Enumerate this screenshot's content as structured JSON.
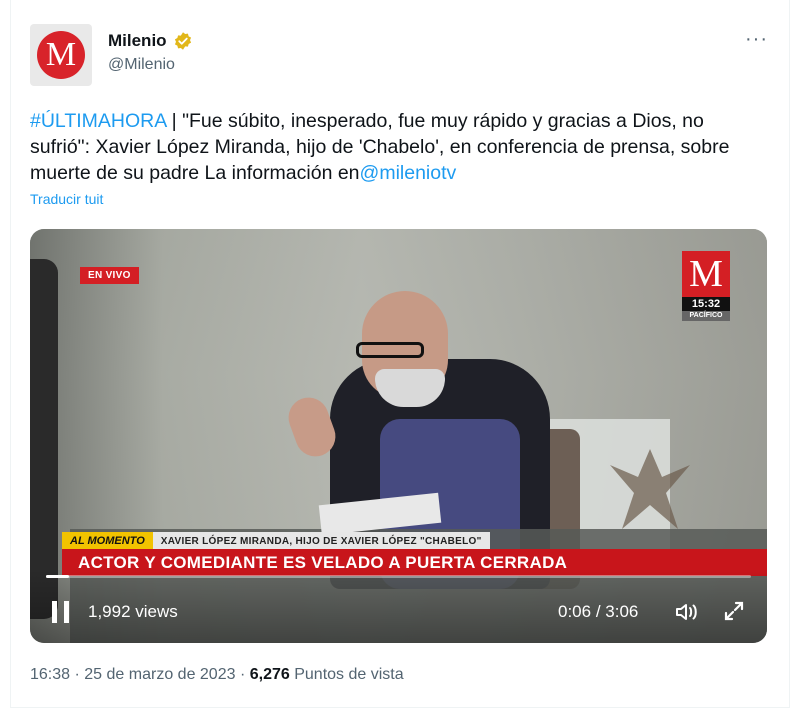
{
  "author": {
    "name": "Milenio",
    "handle": "@Milenio",
    "avatar_letter": "M"
  },
  "menu": {
    "more_label": "···"
  },
  "tweet": {
    "hashtag": "#ÚLTIMAHORA",
    "body": " | \"Fue súbito, inesperado, fue muy rápido y gracias a Dios, no sufrió\": Xavier López Miranda, hijo de 'Chabelo', en conferencia de prensa, sobre muerte de su padre La información en",
    "mention": "@mileniotv",
    "translate_label": "Traducir tuit"
  },
  "video": {
    "live_badge": "EN VIVO",
    "channel_letter": "M",
    "channel_time": "15:32",
    "channel_zone": "PACÍFICO",
    "lower_third": {
      "tag": "AL MOMENTO",
      "subtitle": "XAVIER LÓPEZ MIRANDA, HIJO DE XAVIER LÓPEZ \"CHABELO\"",
      "headline": "ACTOR Y COMEDIANTE ES VELADO A PUERTA CERRADA"
    },
    "views": "1,992 views",
    "elapsed": "0:06",
    "duration": "3:06",
    "progress_fraction": 0.033
  },
  "meta": {
    "time": "16:38",
    "date": "25 de marzo de 2023",
    "views_count": "6,276",
    "views_label": "Puntos de vista",
    "separator": "·"
  },
  "colors": {
    "accent": "#1d9bf0",
    "brand_red": "#d8232a",
    "verified_gold": "#e2b719",
    "muted": "#536471"
  }
}
